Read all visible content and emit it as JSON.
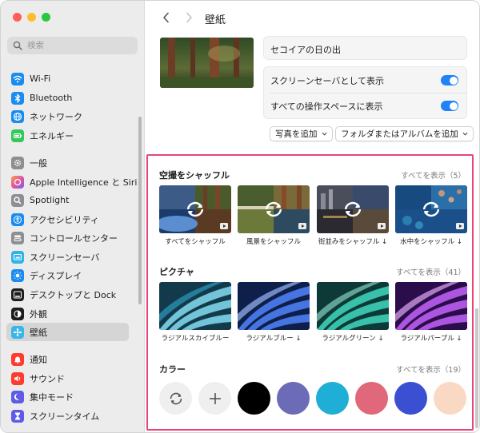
{
  "window": {
    "title": "壁紙"
  },
  "sidebar": {
    "search_placeholder": "検索",
    "items": [
      {
        "label": "Wi-Fi",
        "color": "#1a8cf0",
        "icon": "wifi-icon"
      },
      {
        "label": "Bluetooth",
        "color": "#1a8cf0",
        "icon": "bluetooth-icon"
      },
      {
        "label": "ネットワーク",
        "color": "#1a8cf0",
        "icon": "globe-icon"
      },
      {
        "label": "エネルギー",
        "color": "#34c759",
        "icon": "battery-icon"
      },
      {
        "label": "一般",
        "color": "#8e8e93",
        "icon": "gear-icon"
      },
      {
        "label": "Apple Intelligence と Siri",
        "color": "#e5569a",
        "icon": "siri-icon"
      },
      {
        "label": "Spotlight",
        "color": "#8e8e93",
        "icon": "spotlight-icon"
      },
      {
        "label": "アクセシビリティ",
        "color": "#1a8cf0",
        "icon": "accessibility-icon"
      },
      {
        "label": "コントロールセンター",
        "color": "#8e8e93",
        "icon": "control-center-icon"
      },
      {
        "label": "スクリーンセーバ",
        "color": "#2fb4e8",
        "icon": "screensaver-icon"
      },
      {
        "label": "ディスプレイ",
        "color": "#1a8cf0",
        "icon": "display-icon"
      },
      {
        "label": "デスクトップと Dock",
        "color": "#1e1e1e",
        "icon": "dock-icon"
      },
      {
        "label": "外観",
        "color": "#1e1e1e",
        "icon": "appearance-icon"
      },
      {
        "label": "壁紙",
        "color": "#39b6e8",
        "icon": "wallpaper-icon",
        "selected": true
      },
      {
        "label": "通知",
        "color": "#ff3b30",
        "icon": "bell-icon"
      },
      {
        "label": "サウンド",
        "color": "#ff3b30",
        "icon": "speaker-icon"
      },
      {
        "label": "集中モード",
        "color": "#5e5ce6",
        "icon": "moon-icon"
      },
      {
        "label": "スクリーンタイム",
        "color": "#5e5ce6",
        "icon": "hourglass-icon"
      }
    ]
  },
  "main": {
    "current_wallpaper": "セコイアの日の出",
    "show_as_screensaver": {
      "label": "スクリーンセーバとして表示",
      "on": true
    },
    "show_all_spaces": {
      "label": "すべての操作スペースに表示",
      "on": true
    },
    "add_photo": "写真を追加",
    "add_folder": "フォルダまたはアルバムを追加",
    "sections": {
      "aerial": {
        "title": "空撮をシャッフル",
        "show_all": "すべてを表示（5）",
        "items": [
          "すべてをシャッフル",
          "風景をシャッフル",
          "街並みをシャッフル ↓",
          "水中をシャッフル ↓"
        ]
      },
      "pictures": {
        "title": "ピクチャ",
        "show_all": "すべてを表示（41）",
        "items": [
          "ラジアルスカイブルー",
          "ラジアルブルー ↓",
          "ラジアルグリーン ↓",
          "ラジアルパープル ↓"
        ]
      },
      "colors": {
        "title": "カラー",
        "show_all": "すべてを表示（19）",
        "swatches": [
          "#000000",
          "#6b6bb8",
          "#1faed6",
          "#e0687a",
          "#3a4fd2",
          "#fad9c4"
        ]
      }
    }
  }
}
